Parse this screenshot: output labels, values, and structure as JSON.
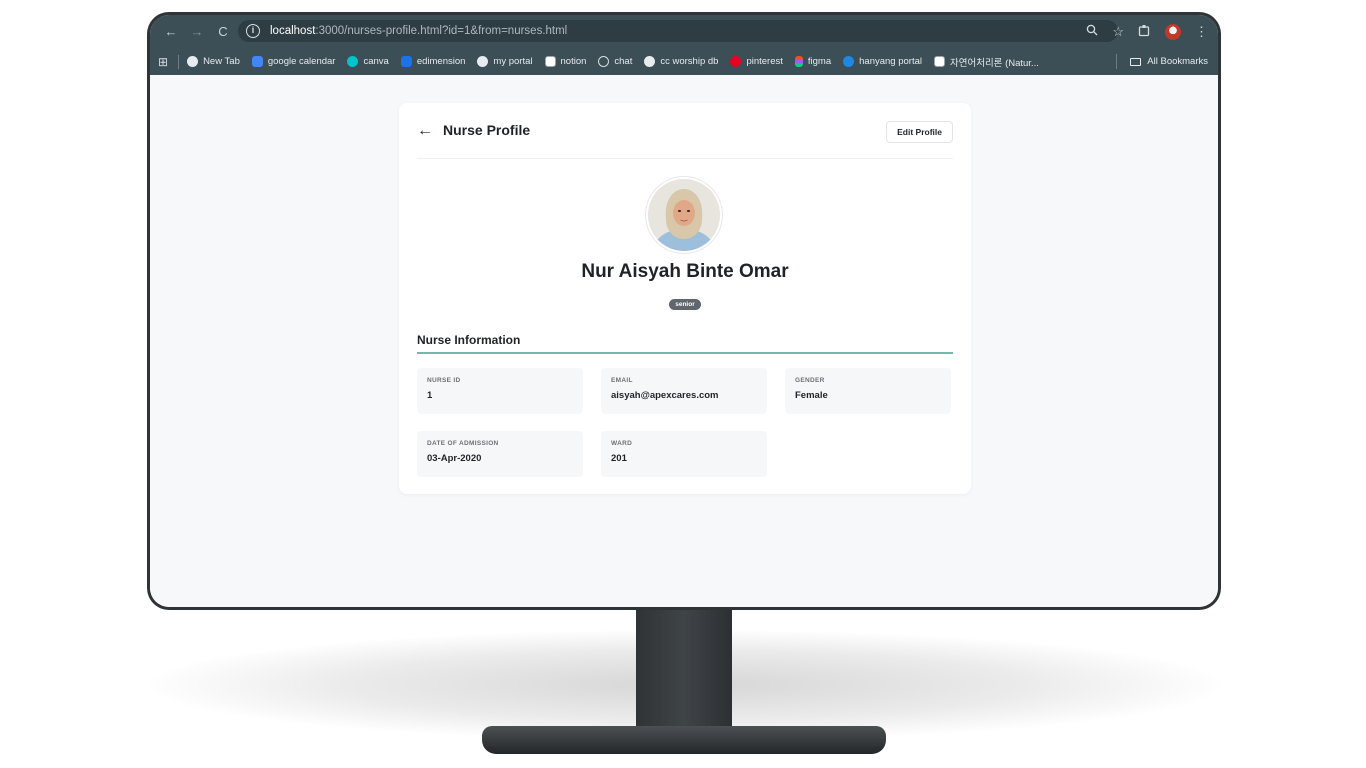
{
  "browser": {
    "url_host": "localhost",
    "url_rest": ":3000/nurses-profile.html?id=1&from=nurses.html",
    "bookmarks": [
      {
        "label": "New Tab",
        "icon": "globe-icon",
        "color": "#e6ecef"
      },
      {
        "label": "google calendar",
        "icon": "calendar-icon",
        "color": "#4285f4"
      },
      {
        "label": "canva",
        "icon": "canva-icon",
        "color": "#00c4cc"
      },
      {
        "label": "edimension",
        "icon": "edimension-icon",
        "color": "#1a73e8"
      },
      {
        "label": "my portal",
        "icon": "globe-icon",
        "color": "#e6ecef"
      },
      {
        "label": "notion",
        "icon": "notion-icon",
        "color": "#ffffff"
      },
      {
        "label": "chat",
        "icon": "chat-icon",
        "color": "#d5dde0"
      },
      {
        "label": "cc worship db",
        "icon": "globe-icon",
        "color": "#e6ecef"
      },
      {
        "label": "pinterest",
        "icon": "pinterest-icon",
        "color": "#e60023"
      },
      {
        "label": "figma",
        "icon": "figma-icon",
        "color": "#f24e1e"
      },
      {
        "label": "hanyang portal",
        "icon": "hanyang-icon",
        "color": "#1e88e5"
      },
      {
        "label": "자연어처리론 (Natur...",
        "icon": "notion-icon",
        "color": "#ffffff"
      }
    ],
    "all_bookmarks_label": "All Bookmarks"
  },
  "header": {
    "back_arrow": "←",
    "title": "Nurse Profile",
    "edit_label": "Edit Profile"
  },
  "profile": {
    "name": "Nur Aisyah Binte Omar",
    "level": "senior"
  },
  "section": {
    "title": "Nurse Information"
  },
  "info": {
    "nurse_id": {
      "label": "NURSE ID",
      "value": "1"
    },
    "email": {
      "label": "EMAIL",
      "value": "aisyah@apexcares.com"
    },
    "gender": {
      "label": "GENDER",
      "value": "Female"
    },
    "admission": {
      "label": "DATE OF ADMISSION",
      "value": "03-Apr-2020"
    },
    "ward": {
      "label": "WARD",
      "value": "201"
    }
  },
  "colors": {
    "chrome": "#3c4e56",
    "accent_underline": "#6fb9ad",
    "badge": "#5f666c"
  }
}
